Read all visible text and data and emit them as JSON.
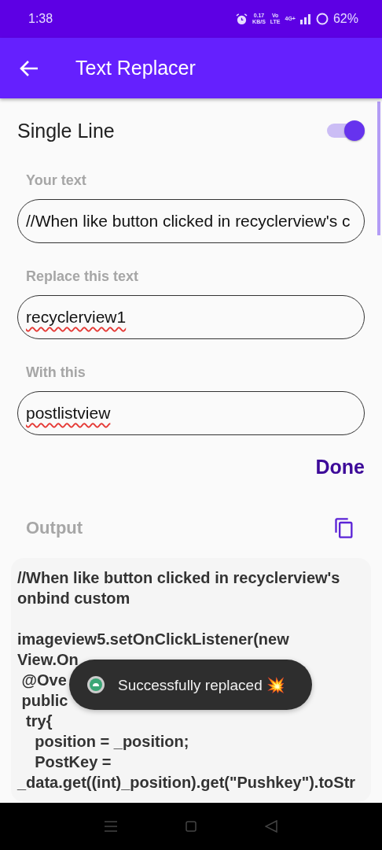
{
  "status_bar": {
    "time": "1:38",
    "speed_value": "0.17",
    "speed_unit": "KB/S",
    "volte_top": "Vo",
    "volte_bottom": "LTE",
    "network": "4G+",
    "battery": "62%"
  },
  "app_bar": {
    "title": "Text Replacer"
  },
  "single_line": {
    "label": "Single Line",
    "on": true
  },
  "fields": [
    {
      "label": "Your text",
      "value": "//When like button clicked in recyclerview's c",
      "spell_error": false
    },
    {
      "label": "Replace this text",
      "value": "recyclerview1",
      "spell_error": true
    },
    {
      "label": "With this",
      "value": "postlistview",
      "spell_error": true
    }
  ],
  "done_button": "Done",
  "output": {
    "label": "Output",
    "paragraphs": [
      [
        "//When like button clicked in recyclerview's",
        "onbind custom"
      ],
      [
        "imageview5.setOnClickListener(new",
        "View.On",
        " @Ove",
        " public",
        "  try{",
        "    position = _position;",
        "    PostKey =",
        "_data.get((int)_position).get(\"Pushkey\").toStr"
      ]
    ]
  },
  "toast": {
    "message": "Successfully replaced 💥"
  }
}
